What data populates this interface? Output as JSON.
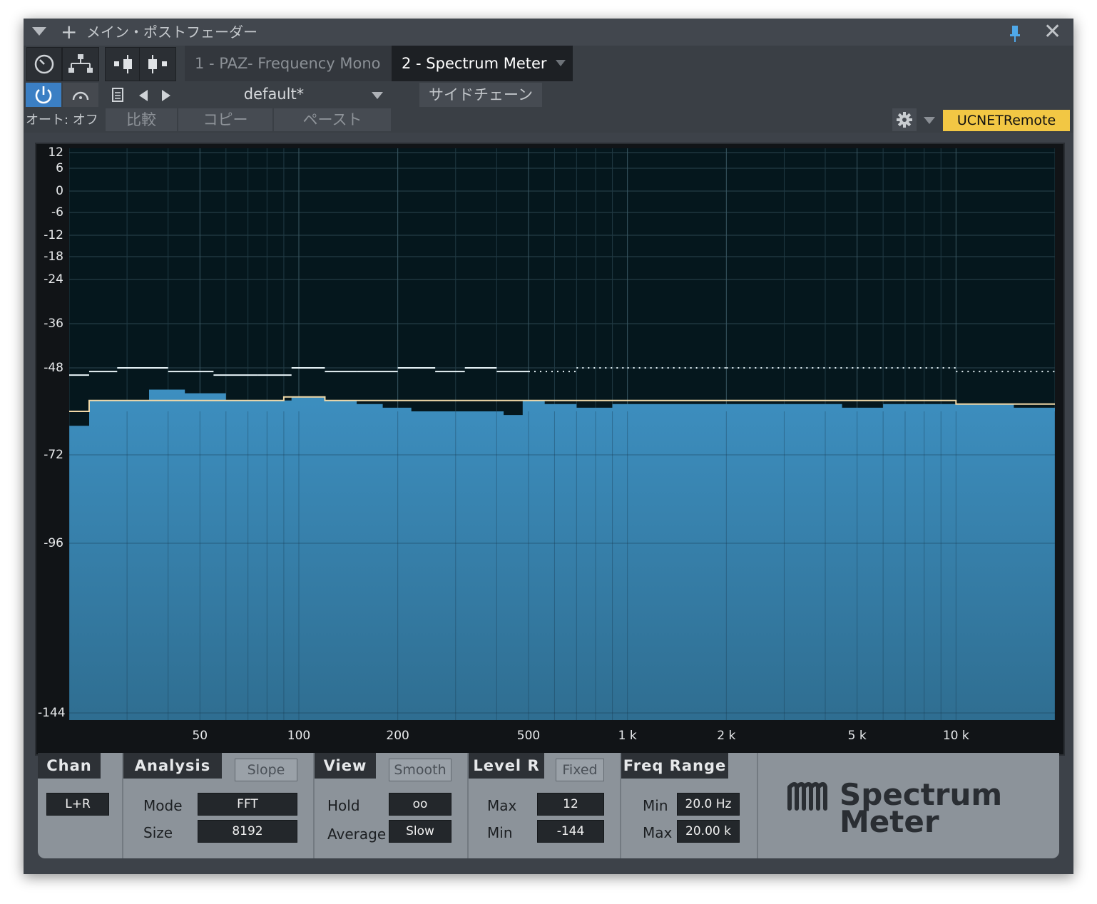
{
  "window": {
    "title": "メイン・ポストフェーダー"
  },
  "tabs": [
    {
      "label": "1 - PAZ- Frequency Mono",
      "active": false
    },
    {
      "label": "2 - Spectrum Meter",
      "active": true
    }
  ],
  "preset": {
    "name": "default*"
  },
  "sidechain_label": "サイドチェーン",
  "auto_label": "オート: オフ",
  "compare_label": "比較",
  "copy_label": "コピー",
  "paste_label": "ペースト",
  "remote_label": "UCNETRemote",
  "colors": {
    "accent_yellow": "#f2c744",
    "spectrum_fill": "#3d8fc0",
    "pin_blue": "#4fa8e8",
    "power_blue": "#3b7fc4"
  },
  "chart_data": {
    "type": "area",
    "x_scale": "log",
    "xlim": [
      20,
      20000
    ],
    "ylim": [
      -144,
      12
    ],
    "y_ticks": [
      12,
      6,
      0,
      -6,
      -12,
      -18,
      -24,
      -36,
      -48,
      -72,
      -96,
      -144
    ],
    "y_tick_labels": [
      "12",
      "6",
      "0",
      "-6",
      "-12",
      "-18",
      "-24",
      "-36",
      "-48",
      "-72",
      "-96",
      "-144"
    ],
    "x_ticks": [
      50,
      100,
      200,
      500,
      1000,
      2000,
      5000,
      10000
    ],
    "x_tick_labels": [
      "50",
      "100",
      "200",
      "500",
      "1 k",
      "2 k",
      "5 k",
      "10 k"
    ],
    "grid": true,
    "series": [
      {
        "kind": "level",
        "x": [
          20,
          23,
          28,
          35,
          45,
          60,
          75,
          95,
          120,
          150,
          180,
          220,
          280,
          350,
          420,
          480,
          560,
          700,
          900,
          1200,
          1600,
          2000,
          2600,
          3500,
          4500,
          6000,
          8000,
          11000,
          15000,
          20000
        ],
        "y": [
          -64,
          -57,
          -57,
          -54,
          -55,
          -57,
          -57,
          -56,
          -57,
          -58,
          -59,
          -60,
          -60,
          -60,
          -61,
          -57,
          -58,
          -59,
          -58,
          -58,
          -58,
          -58,
          -58,
          -58,
          -59,
          -58,
          -58,
          -58,
          -59,
          -59
        ]
      },
      {
        "kind": "average",
        "x": [
          20,
          23,
          28,
          40,
          60,
          90,
          120,
          160,
          220,
          300,
          400,
          500,
          700,
          1000,
          2000,
          5000,
          10000,
          20000
        ],
        "y": [
          -60,
          -57,
          -57,
          -57,
          -57,
          -56,
          -57,
          -57,
          -57,
          -57,
          -57,
          -57,
          -57,
          -57,
          -57,
          -57,
          -58,
          -58
        ]
      },
      {
        "kind": "hold",
        "x": [
          20,
          23,
          28,
          40,
          55,
          75,
          95,
          120,
          150,
          200,
          260,
          320,
          400,
          500,
          700,
          1000,
          2000,
          5000,
          10000,
          20000
        ],
        "y": [
          -50,
          -49,
          -48,
          -49,
          -50,
          -50,
          -48,
          -49,
          -49,
          -48,
          -49,
          -48,
          -49,
          -49,
          -48,
          -48,
          -48,
          -48,
          -49,
          -51
        ]
      }
    ]
  },
  "controls": {
    "chan": {
      "header": "Chan",
      "value": "L+R"
    },
    "analysis": {
      "header": "Analysis",
      "slope_label": "Slope",
      "mode_label": "Mode",
      "mode_value": "FFT",
      "size_label": "Size",
      "size_value": "8192"
    },
    "view": {
      "header": "View",
      "smooth_label": "Smooth",
      "hold_label": "Hold",
      "hold_value": "oo",
      "average_label": "Average",
      "average_value": "Slow"
    },
    "level": {
      "header": "Level R",
      "fixed_label": "Fixed",
      "max_label": "Max",
      "max_value": "12",
      "min_label": "Min",
      "min_value": "-144"
    },
    "freq": {
      "header": "Freq Range",
      "min_label": "Min",
      "min_value": "20.0 Hz",
      "max_label": "Max",
      "max_value": "20.00 k"
    },
    "logo": {
      "line1": "Spectrum",
      "line2": "Meter"
    }
  }
}
